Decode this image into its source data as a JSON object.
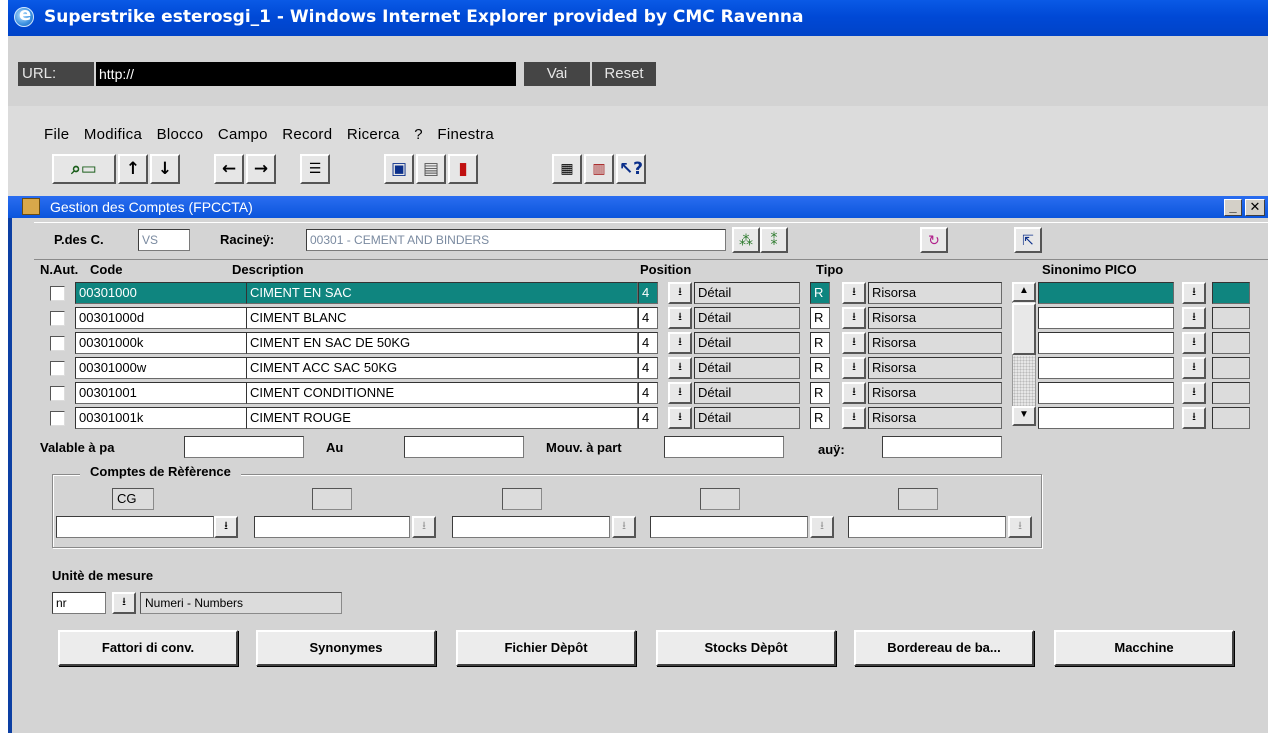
{
  "window": {
    "title": "Superstrike esterosgi_1 - Windows Internet Explorer provided by CMC Ravenna"
  },
  "urlbar": {
    "label": "URL:",
    "value": "http://",
    "go": "Vai",
    "reset": "Reset"
  },
  "menu": [
    "File",
    "Modifica",
    "Blocco",
    "Campo",
    "Record",
    "Ricerca",
    "?",
    "Finestra"
  ],
  "toolbar_icons": [
    "enter-query-icon",
    "arrow-up-icon",
    "arrow-down-icon",
    "arrow-left-icon",
    "arrow-right-icon",
    "list-icon",
    "save-icon",
    "delete-icon",
    "exit-icon",
    "clipboard-icon",
    "copy-icon",
    "help-icon"
  ],
  "inner": {
    "title": "Gestion des Comptes (FPCCTA)",
    "pdc_label": "P.des C.",
    "pdc_value": "VS",
    "root_label": "Racineÿ:",
    "root_value": "00301 - CEMENT AND BINDERS"
  },
  "grid": {
    "headers": {
      "naut": "N.Aut.",
      "code": "Code",
      "description": "Description",
      "position": "Position",
      "tipo": "Tipo",
      "sinonimo": "Sinonimo PICO"
    },
    "rows": [
      {
        "code": "00301000",
        "desc": "CIMENT EN SAC",
        "pos": "4",
        "pos_text": "Détail",
        "tipo": "R",
        "tipo_text": "Risorsa"
      },
      {
        "code": "00301000d",
        "desc": "CIMENT BLANC",
        "pos": "4",
        "pos_text": "Détail",
        "tipo": "R",
        "tipo_text": "Risorsa"
      },
      {
        "code": "00301000k",
        "desc": "CIMENT EN SAC DE 50KG",
        "pos": "4",
        "pos_text": "Détail",
        "tipo": "R",
        "tipo_text": "Risorsa"
      },
      {
        "code": "00301000w",
        "desc": "CIMENT ACC  SAC 50KG",
        "pos": "4",
        "pos_text": "Détail",
        "tipo": "R",
        "tipo_text": "Risorsa"
      },
      {
        "code": "00301001",
        "desc": "CIMENT CONDITIONNE",
        "pos": "4",
        "pos_text": "Détail",
        "tipo": "R",
        "tipo_text": "Risorsa"
      },
      {
        "code": "00301001k",
        "desc": "CIMENT ROUGE",
        "pos": "4",
        "pos_text": "Détail",
        "tipo": "R",
        "tipo_text": "Risorsa"
      }
    ]
  },
  "validity": {
    "from_label": "Valable à pa",
    "to_label": "Au",
    "mouv_label": "Mouv. à part",
    "auy_label": "auÿ:"
  },
  "refs": {
    "title": "Comptes de Rèfèrence",
    "first_code": "CG"
  },
  "unit": {
    "label": "Unitè de mesure",
    "code": "nr",
    "text": "Numeri - Numbers"
  },
  "buttons": {
    "fattori": "Fattori di conv.",
    "synonymes": "Synonymes",
    "fichier": "Fichier Dèpôt",
    "stocks": "Stocks Dèpôt",
    "bordereau": "Bordereau de ba...",
    "macchine": "Macchine"
  },
  "colors": {
    "title_blue": "#0049d6",
    "selection": "#0f857f",
    "form_bg": "#d4d4d4"
  }
}
